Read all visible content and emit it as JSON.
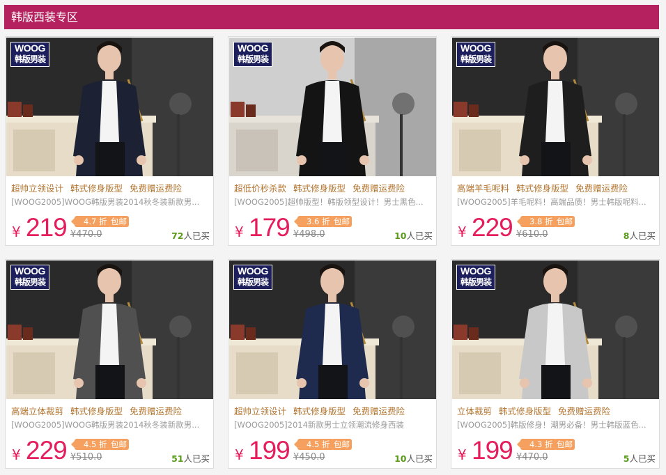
{
  "section": {
    "title": "韩版西装专区"
  },
  "brand": {
    "logo_line1": "WOOG",
    "logo_line2": "韩版男装"
  },
  "colors": {
    "accent": "#b4215e",
    "price": "#e61d5c",
    "tag": "#b3742f",
    "badge": "#f5a05e",
    "sold": "#5a9a1a"
  },
  "currency": "¥",
  "sold_suffix": "人已买",
  "products": [
    {
      "tags": [
        "超帅立领设计",
        "韩式修身版型",
        "免费赠运费险"
      ],
      "desc": "[WOOG2005]WOOG韩版男装2014秋冬装新款男...",
      "price": "219",
      "discount": "4.7 折",
      "shipping": "包邮",
      "original": "¥470.0",
      "sold": "72",
      "jacket": "#1c2233"
    },
    {
      "tags": [
        "超低价秒杀款",
        "韩式修身版型",
        "免费赠运费险"
      ],
      "desc": "[WOOG2005]超帅版型！韩版领型设计！男士黑色...",
      "price": "179",
      "discount": "3.6 折",
      "shipping": "包邮",
      "original": "¥498.0",
      "sold": "10",
      "jacket": "#141414"
    },
    {
      "tags": [
        "高端羊毛呢料",
        "韩式修身版型",
        "免费赠运费险"
      ],
      "desc": "[WOOG2005]羊毛呢料！高端品质！男士韩版呢料...",
      "price": "229",
      "discount": "3.8 折",
      "shipping": "包邮",
      "original": "¥610.0",
      "sold": "8",
      "jacket": "#1e1e1e"
    },
    {
      "tags": [
        "高端立体裁剪",
        "韩式修身版型",
        "免费赠运费险"
      ],
      "desc": "[WOOG2005]WOOG韩版男装2014秋冬装新款男...",
      "price": "229",
      "discount": "4.5 折",
      "shipping": "包邮",
      "original": "¥510.0",
      "sold": "51",
      "jacket": "#505050"
    },
    {
      "tags": [
        "超帅立领设计",
        "韩式修身版型",
        "免费赠运费险"
      ],
      "desc": "[WOOG2005]2014新款男士立领潮流修身西装",
      "price": "199",
      "discount": "4.5 折",
      "shipping": "包邮",
      "original": "¥450.0",
      "sold": "10",
      "jacket": "#1f2b4e"
    },
    {
      "tags": [
        "立体裁剪",
        "韩式修身版型",
        "免费赠运费险"
      ],
      "desc": "[WOOG2005]韩版修身！潮男必备！男士韩版蓝色...",
      "price": "199",
      "discount": "4.3 折",
      "shipping": "包邮",
      "original": "¥470.0",
      "sold": "5",
      "jacket": "#c8c8c8"
    }
  ]
}
